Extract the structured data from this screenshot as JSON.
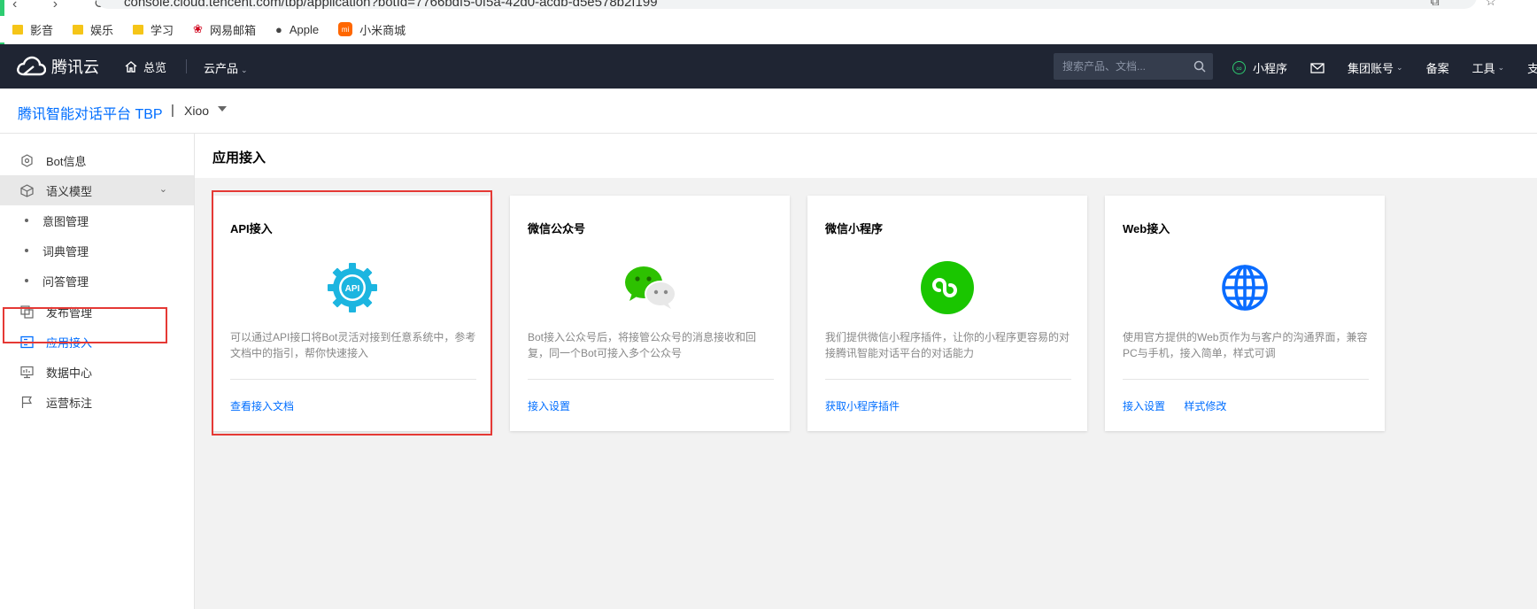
{
  "browser": {
    "url": "console.cloud.tencent.com/tbp/application?botId=7766bdf5-0f5a-42d0-acdb-d5e578b2f199",
    "nav_glyphs": "‹ › ↻",
    "right_glyphs": "⧉ ☆"
  },
  "bookmarks": [
    {
      "label": "影音",
      "icon": "folder-icon"
    },
    {
      "label": "娱乐",
      "icon": "folder-icon"
    },
    {
      "label": "学习",
      "icon": "folder-icon"
    },
    {
      "label": "网易邮箱",
      "icon": "netease-icon"
    },
    {
      "label": "Apple",
      "icon": "apple-icon"
    },
    {
      "label": "小米商城",
      "icon": "mi-icon"
    }
  ],
  "topnav": {
    "logo_text": "腾讯云",
    "home_label": "总览",
    "products_label": "云产品",
    "search_placeholder": "搜索产品、文档...",
    "miniprogram_label": "小程序",
    "account_label": "集团账号",
    "beian_label": "备案",
    "tools_label": "工具",
    "support_label": "支"
  },
  "product": {
    "title": "腾讯智能对话平台 TBP",
    "separator": "|",
    "bot_name": "Xioo"
  },
  "sidebar": {
    "items": [
      {
        "label": "Bot信息",
        "icon": "bot-info-icon"
      },
      {
        "label": "语义模型",
        "icon": "cube-icon"
      },
      {
        "label": "意图管理"
      },
      {
        "label": "词典管理"
      },
      {
        "label": "问答管理"
      },
      {
        "label": "发布管理",
        "icon": "publish-icon"
      },
      {
        "label": "应用接入",
        "icon": "app-access-icon"
      },
      {
        "label": "数据中心",
        "icon": "monitor-icon"
      },
      {
        "label": "运营标注",
        "icon": "flag-icon"
      }
    ]
  },
  "main": {
    "title": "应用接入",
    "cards": [
      {
        "title": "API接入",
        "icon": "api-gear-icon",
        "icon_text": "API",
        "desc": "可以通过API接口将Bot灵活对接到任意系统中，参考文档中的指引，帮你快速接入",
        "links": [
          "查看接入文档"
        ]
      },
      {
        "title": "微信公众号",
        "icon": "wechat-icon",
        "desc": "Bot接入公众号后，将接管公众号的消息接收和回复，同一个Bot可接入多个公众号",
        "links": [
          "接入设置"
        ]
      },
      {
        "title": "微信小程序",
        "icon": "miniprogram-icon",
        "desc": "我们提供微信小程序插件，让你的小程序更容易的对接腾讯智能对话平台的对话能力",
        "links": [
          "获取小程序插件"
        ]
      },
      {
        "title": "Web接入",
        "icon": "globe-icon",
        "desc": "使用官方提供的Web页作为与客户的沟通界面，兼容PC与手机，接入简单，样式可调",
        "links": [
          "接入设置",
          "样式修改"
        ]
      }
    ]
  },
  "colors": {
    "accent": "#006eff",
    "topnav_bg": "#1f2533",
    "highlight_border": "#e53935",
    "wechat_green": "#2dc100",
    "api_blue": "#1cb5e0"
  }
}
